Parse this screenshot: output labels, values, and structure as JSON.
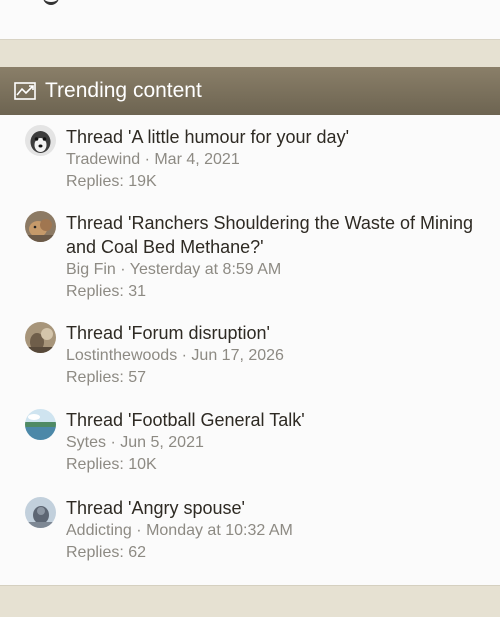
{
  "widget": {
    "title": "Trending content",
    "items": [
      {
        "title": "Thread 'A little humour for your day'",
        "author": "Tradewind",
        "separator": "·",
        "date": "Mar 4, 2021",
        "replies": "Replies: 19K",
        "avatar_colors": [
          "#d9d9d9",
          "#444444"
        ]
      },
      {
        "title": "Thread 'Ranchers Shouldering the Waste of Mining and Coal Bed Methane?'",
        "author": "Big Fin",
        "separator": "·",
        "date": "Yesterday at 8:59 AM",
        "replies": "Replies: 31",
        "avatar_colors": [
          "#8c7a64",
          "#c9a070"
        ]
      },
      {
        "title": "Thread 'Forum disruption'",
        "author": "Lostinthewoods",
        "separator": "·",
        "date": "Jun 17, 2026",
        "replies": "Replies: 57",
        "avatar_colors": [
          "#7b6a55",
          "#c8b79c"
        ]
      },
      {
        "title": "Thread 'Football General Talk'",
        "author": "Sytes",
        "separator": "·",
        "date": "Jun 5, 2021",
        "replies": "Replies: 10K",
        "avatar_colors": [
          "#bcd8e8",
          "#3f7a5a"
        ]
      },
      {
        "title": "Thread 'Angry spouse'",
        "author": "Addicting",
        "separator": "·",
        "date": "Monday at 10:32 AM",
        "replies": "Replies: 62",
        "avatar_colors": [
          "#b9c8d6",
          "#5a6470"
        ]
      }
    ]
  },
  "colors": {
    "page_bg": "#e6e1d2",
    "header_bg": "#7b715d",
    "title_text": "#2e2a23",
    "meta_text": "#8d8a83"
  }
}
